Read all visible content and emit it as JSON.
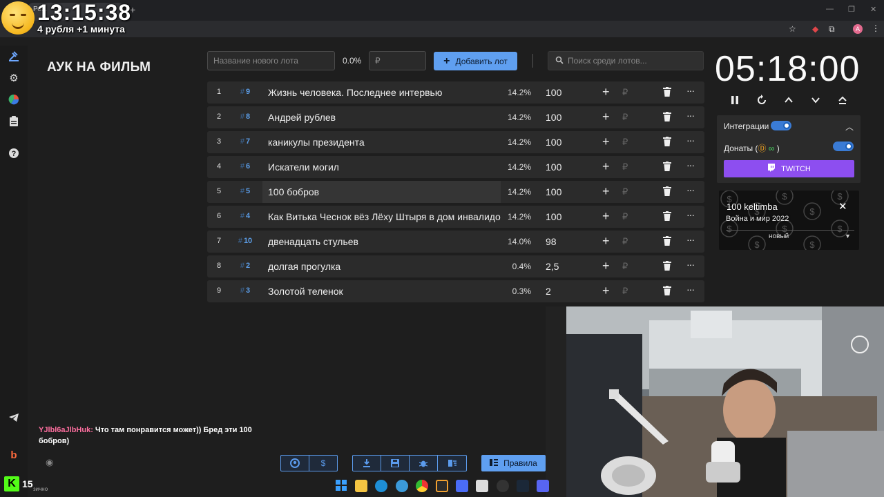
{
  "browser": {
    "tab_title": "Ро...",
    "new_tab": "+",
    "profile_initial": "A"
  },
  "overlay": {
    "clock": "13:15:38",
    "rule": "4 рубля +1 минута",
    "kick_viewers": "15",
    "kick_logo": "K",
    "tiny_label": "зично"
  },
  "page": {
    "title": "АУК НА ФИЛЬМ"
  },
  "toolbar": {
    "lot_name_placeholder": "Название нового лота",
    "percent": "0.0%",
    "amount_placeholder": "₽",
    "add_label": "Добавить лот",
    "search_placeholder": "Поиск среди лотов..."
  },
  "lots": [
    {
      "num": "1",
      "id": "9",
      "name": "Жизнь человека. Последнее интервью",
      "pct": "14.2%",
      "amount": "100"
    },
    {
      "num": "2",
      "id": "8",
      "name": "Андрей рублев",
      "pct": "14.2%",
      "amount": "100"
    },
    {
      "num": "3",
      "id": "7",
      "name": "каникулы президента",
      "pct": "14.2%",
      "amount": "100"
    },
    {
      "num": "4",
      "id": "6",
      "name": "Искатели могил",
      "pct": "14.2%",
      "amount": "100"
    },
    {
      "num": "5",
      "id": "5",
      "name": "100 бобров",
      "pct": "14.2%",
      "amount": "100"
    },
    {
      "num": "6",
      "id": "4",
      "name": "Как Витька Чеснок вёз Лёху Штыря в дом инвалидов",
      "pct": "14.2%",
      "amount": "100"
    },
    {
      "num": "7",
      "id": "10",
      "name": "двенадцать стульев",
      "pct": "14.0%",
      "amount": "98"
    },
    {
      "num": "8",
      "id": "2",
      "name": "долгая прогулка",
      "pct": "0.4%",
      "amount": "2,5"
    },
    {
      "num": "9",
      "id": "3",
      "name": "Золотой теленок",
      "pct": "0.3%",
      "amount": "2"
    }
  ],
  "lot_symbols": {
    "hash": "#",
    "plus": "+",
    "ruble": "₽",
    "more": "···"
  },
  "timer": {
    "value": "05:18:00"
  },
  "integrations": {
    "label": "Интеграции",
    "donations_label": "Донаты (",
    "donations_suffix": ")",
    "twitch_label": "TWITCH",
    "integrations_on": true,
    "donations_on": true
  },
  "donation": {
    "from": "100 keltimba",
    "message": "Война и мир 2022",
    "select_value": "новый"
  },
  "chat": {
    "user": "YJlbl6aJlbHuk:",
    "text": " Что там понравится может)) Бред эти 100 бобров)"
  },
  "rules_label": "Правила",
  "colors": {
    "accent": "#5f9ff0",
    "twitch": "#8d4ef0",
    "background": "#1e1e1e",
    "row": "#2b2b2b",
    "id": "#5c9de6",
    "chat_user": "#ff6fa0"
  }
}
